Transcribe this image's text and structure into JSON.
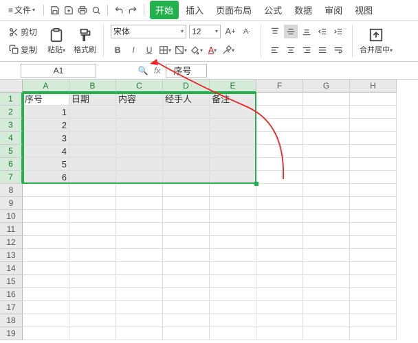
{
  "menubar": {
    "file": "文件",
    "tabs": [
      "开始",
      "插入",
      "页面布局",
      "公式",
      "数据",
      "审阅",
      "视图"
    ],
    "active_tab": "开始"
  },
  "ribbon": {
    "cut": "剪切",
    "copy": "复制",
    "paste": "粘贴",
    "fmt_painter": "格式刷",
    "font_name": "宋体",
    "font_size": "12",
    "merge_center": "合并居中"
  },
  "namebox": "A1",
  "formula_value": "序号",
  "columns": [
    "A",
    "B",
    "C",
    "D",
    "E",
    "F",
    "G",
    "H"
  ],
  "sel_cols": 5,
  "sel_rows": 7,
  "row_count": 19,
  "headers": [
    "序号",
    "日期",
    "内容",
    "经手人",
    "备注"
  ],
  "data_rows": [
    [
      "1",
      "",
      "",
      "",
      ""
    ],
    [
      "2",
      "",
      "",
      "",
      ""
    ],
    [
      "3",
      "",
      "",
      "",
      ""
    ],
    [
      "4",
      "",
      "",
      "",
      ""
    ],
    [
      "5",
      "",
      "",
      "",
      ""
    ],
    [
      "6",
      "",
      "",
      "",
      ""
    ]
  ]
}
